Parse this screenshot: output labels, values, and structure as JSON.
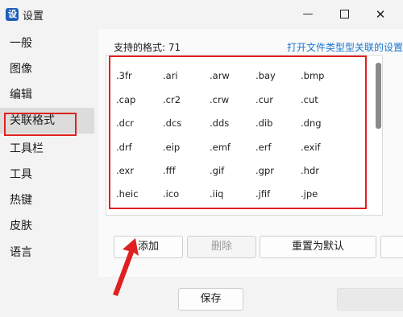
{
  "window": {
    "title": "设置",
    "app_icon_letter": "设"
  },
  "sidebar": {
    "items": [
      {
        "label": "一般"
      },
      {
        "label": "图像"
      },
      {
        "label": "编辑"
      },
      {
        "label": "关联格式",
        "active": true
      },
      {
        "label": "工具栏"
      },
      {
        "label": "工具"
      },
      {
        "label": "热键"
      },
      {
        "label": "皮肤"
      },
      {
        "label": "语言"
      }
    ]
  },
  "main": {
    "header": "支持的格式: 71",
    "link": "打开文件类型型关联的设置",
    "extensions": [
      ".3fr",
      ".ari",
      ".arw",
      ".bay",
      ".bmp",
      ".cap",
      ".cr2",
      ".crw",
      ".cur",
      ".cut",
      ".dcr",
      ".dcs",
      ".dds",
      ".dib",
      ".dng",
      ".drf",
      ".eip",
      ".emf",
      ".erf",
      ".exif",
      ".exr",
      ".fff",
      ".gif",
      ".gpr",
      ".hdr",
      ".heic",
      ".ico",
      ".iiq",
      ".jfif",
      ".jpe"
    ],
    "buttons": {
      "add": "添加",
      "delete": "删除",
      "reset": "重置为默认"
    }
  },
  "footer": {
    "save": "保存"
  },
  "colors": {
    "accent": "#1976d2",
    "annotation": "#e02020",
    "active_item": "#dcdcdc"
  }
}
